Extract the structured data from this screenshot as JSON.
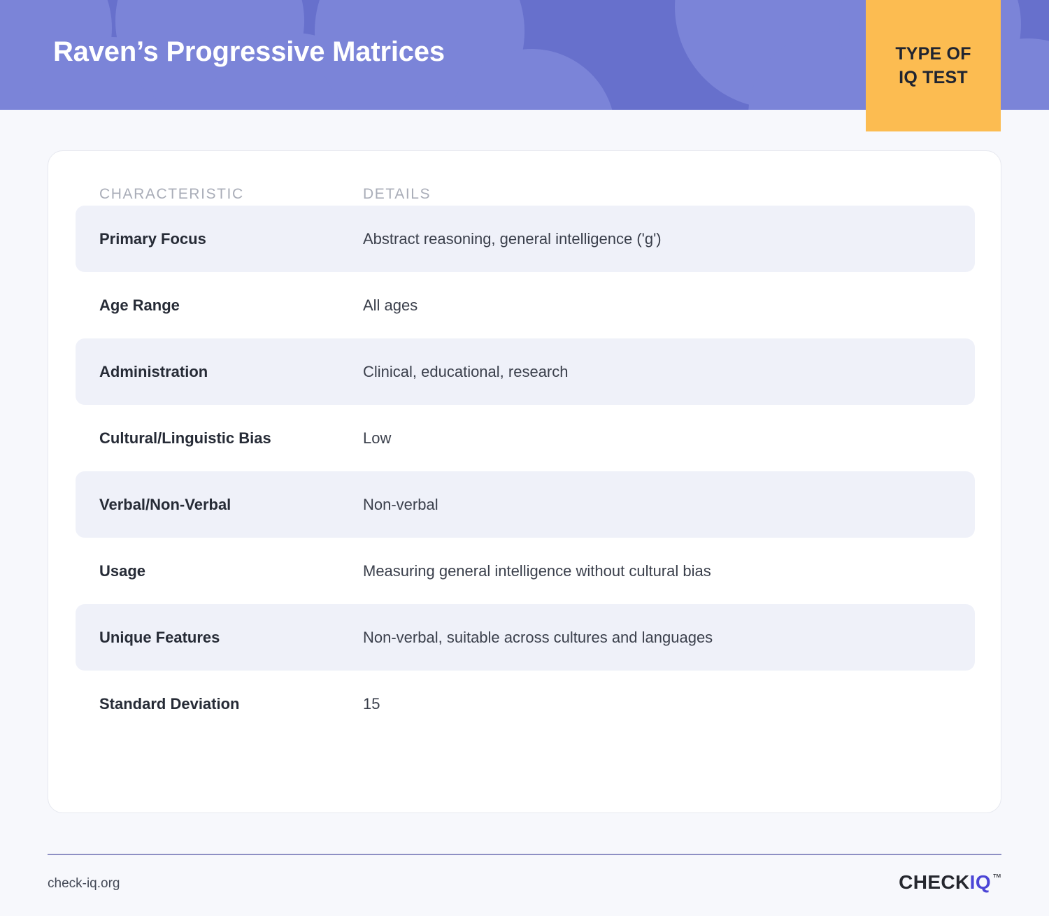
{
  "header": {
    "title": "Raven’s Progressive Matrices",
    "background_color": "#6770CC",
    "circle_color": "#7B84D8"
  },
  "badge": {
    "line1": "TYPE OF",
    "line2": "IQ TEST",
    "background_color": "#FCBC51",
    "text_color": "#1F2430"
  },
  "table": {
    "columns": [
      {
        "key": "characteristic",
        "label": "CHARACTERISTIC"
      },
      {
        "key": "details",
        "label": "DETAILS"
      }
    ],
    "rows": [
      {
        "characteristic": "Primary Focus",
        "details": "Abstract reasoning, general intelligence ('g')",
        "shaded": true
      },
      {
        "characteristic": "Age Range",
        "details": "All ages",
        "shaded": false
      },
      {
        "characteristic": "Administration",
        "details": "Clinical, educational, research",
        "shaded": true
      },
      {
        "characteristic": "Cultural/Linguistic Bias",
        "details": "Low",
        "shaded": false
      },
      {
        "characteristic": "Verbal/Non-Verbal",
        "details": "Non-verbal",
        "shaded": true
      },
      {
        "characteristic": "Usage",
        "details": "Measuring general intelligence without cultural bias",
        "shaded": false
      },
      {
        "characteristic": "Unique Features",
        "details": "Non-verbal, suitable across cultures and languages",
        "shaded": true
      },
      {
        "characteristic": "Standard Deviation",
        "details": "15",
        "shaded": false
      }
    ],
    "row_shade_color": "#EFF1F9"
  },
  "footer": {
    "url": "check-iq.org",
    "logo": {
      "part1": "CHECK",
      "part2": "IQ",
      "trademark": "™",
      "part1_color": "#25272E",
      "part2_color": "#4B45D6"
    },
    "divider_color": "#8E90C4"
  }
}
